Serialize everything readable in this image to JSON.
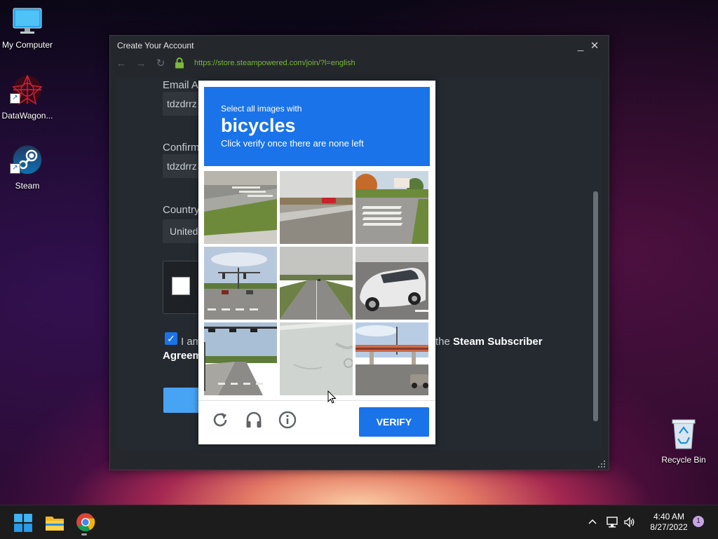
{
  "desktop": {
    "icons": [
      {
        "label": "My Computer"
      },
      {
        "label": "DataWagon..."
      },
      {
        "label": "Steam"
      },
      {
        "label": "Recycle Bin"
      }
    ]
  },
  "window": {
    "title": "Create Your Account",
    "url": "https://store.steampowered.com/join/?l=english",
    "controls": {
      "minimize": "_",
      "close": "✕"
    }
  },
  "form": {
    "email_label": "Email Ad",
    "email_value": "tdzdrrz",
    "confirm_label": "Confirm",
    "confirm_value": "tdzdrrz",
    "country_label": "Country",
    "country_value": "United",
    "agree_prefix": "I am",
    "agree_suffix_pre": "the",
    "agree_link": "Steam Subscriber",
    "agree_line2": "Agreem"
  },
  "captcha": {
    "instruction": "Select all images with",
    "target": "bicycles",
    "subtext": "Click verify once there are none left",
    "verify_label": "VERIFY",
    "icons": [
      "refresh-icon",
      "audio-challenge-icon",
      "info-icon"
    ],
    "tiles": [
      {
        "id": 1,
        "scene": "crosswalk-curb"
      },
      {
        "id": 2,
        "scene": "road-red-car"
      },
      {
        "id": 3,
        "scene": "crosswalk-trees"
      },
      {
        "id": 4,
        "scene": "intersection-traffic-lights"
      },
      {
        "id": 5,
        "scene": "highway"
      },
      {
        "id": 6,
        "scene": "white-car-closeup"
      },
      {
        "id": 7,
        "scene": "road-traffic-lights"
      },
      {
        "id": 8,
        "scene": "blurred-pavement"
      },
      {
        "id": 9,
        "scene": "pedestrian-bridge"
      }
    ]
  },
  "taskbar": {
    "apps": [
      "start-icon",
      "file-explorer-icon",
      "chrome-icon"
    ],
    "time": "4:40 AM",
    "date": "8/27/2022",
    "notification_count": "1"
  }
}
